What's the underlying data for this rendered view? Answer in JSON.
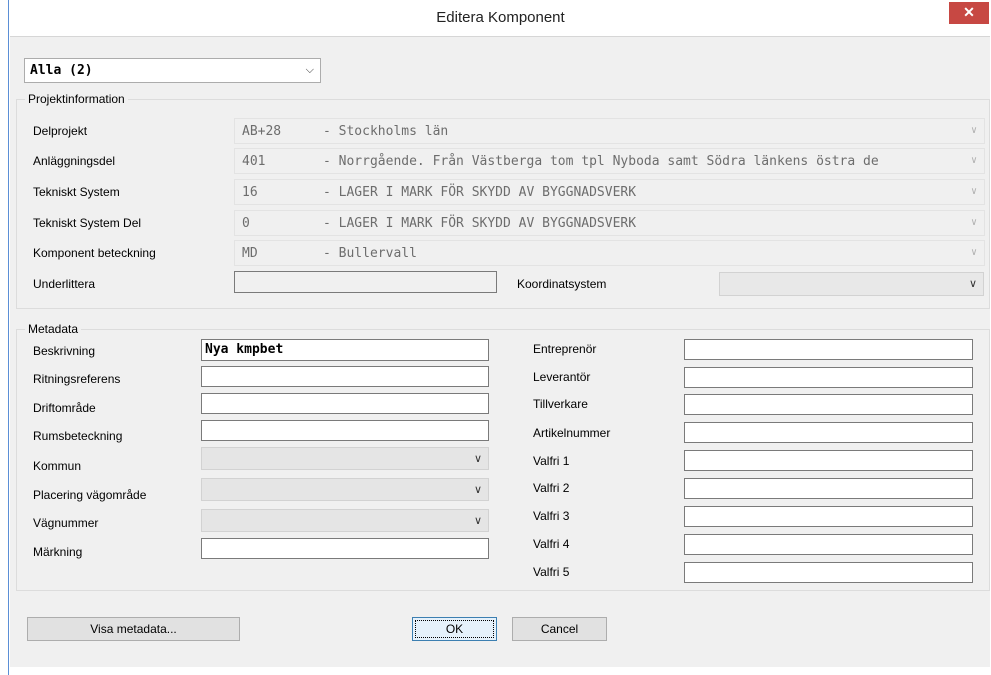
{
  "window": {
    "title": "Editera Komponent",
    "close_glyph": "✕"
  },
  "filter": {
    "selected": "Alla (2)"
  },
  "projekt": {
    "group_title": "Projektinformation",
    "rows": [
      {
        "label": "Delprojekt",
        "code": "AB+28",
        "desc": "- Stockholms län"
      },
      {
        "label": "Anläggningsdel",
        "code": "401",
        "desc": "- Norrgående. Från Västberga tom tpl Nyboda samt Södra länkens östra de"
      },
      {
        "label": "Tekniskt System",
        "code": "16",
        "desc": "- LAGER I MARK FÖR SKYDD AV BYGGNADSVERK"
      },
      {
        "label": "Tekniskt System Del",
        "code": "0",
        "desc": "- LAGER I MARK FÖR SKYDD AV BYGGNADSVERK"
      },
      {
        "label": "Komponent beteckning",
        "code": "MD",
        "desc": "- Bullervall"
      }
    ],
    "underlittera_label": "Underlittera",
    "underlittera_value": "",
    "koordinatsystem_label": "Koordinatsystem",
    "koordinatsystem_value": ""
  },
  "metadata": {
    "group_title": "Metadata",
    "left": {
      "beskrivning_label": "Beskrivning",
      "beskrivning_value": "Nya kmpbet",
      "ritningsreferens_label": "Ritningsreferens",
      "driftomrade_label": "Driftområde",
      "rumsbeteckning_label": "Rumsbeteckning",
      "kommun_label": "Kommun",
      "placering_label": "Placering vägområde",
      "vagnummer_label": "Vägnummer",
      "markning_label": "Märkning"
    },
    "right": {
      "entreprenor_label": "Entreprenör",
      "leverantor_label": "Leverantör",
      "tillverkare_label": "Tillverkare",
      "artikelnummer_label": "Artikelnummer",
      "valfri1_label": "Valfri 1",
      "valfri2_label": "Valfri 2",
      "valfri3_label": "Valfri 3",
      "valfri4_label": "Valfri 4",
      "valfri5_label": "Valfri 5"
    }
  },
  "buttons": {
    "visa_metadata": "Visa metadata...",
    "ok": "OK",
    "cancel": "Cancel"
  },
  "colors": {
    "close": "#c74843",
    "window_border": "#5b8fd6",
    "client_bg": "#f0f0f0"
  }
}
